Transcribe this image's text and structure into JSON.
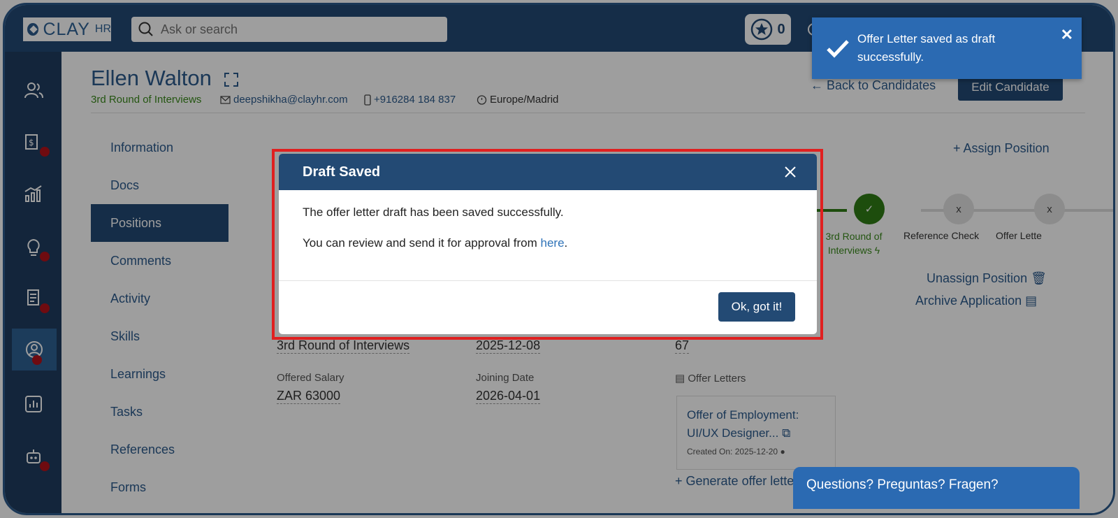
{
  "brand": {
    "name": "CLAY",
    "suffix": "HR"
  },
  "search": {
    "placeholder": "Ask or search"
  },
  "header": {
    "star_count": "0"
  },
  "candidate": {
    "name": "Ellen Walton",
    "stage": "3rd Round of Interviews",
    "email": "deepshikha@clayhr.com",
    "phone": "+916284 184 837",
    "timezone": "Europe/Madrid",
    "back_link": "Back to Candidates",
    "edit_button": "Edit Candidate"
  },
  "nav": {
    "items": [
      {
        "label": "Information"
      },
      {
        "label": "Docs"
      },
      {
        "label": "Positions"
      },
      {
        "label": "Comments"
      },
      {
        "label": "Activity"
      },
      {
        "label": "Skills"
      },
      {
        "label": "Learnings"
      },
      {
        "label": "Tasks"
      },
      {
        "label": "References"
      },
      {
        "label": "Forms"
      }
    ]
  },
  "positions": {
    "assign": "Assign Position",
    "unassign": "Unassign Position",
    "archive": "Archive Application",
    "steps": [
      {
        "label": "3rd Round of Interviews",
        "status": "done",
        "symbol": "✓"
      },
      {
        "label": "Reference Check",
        "status": "pending",
        "symbol": "x"
      },
      {
        "label": "Offer Lette",
        "status": "pending",
        "symbol": "x"
      }
    ],
    "fields": {
      "stage_value": "3rd Round of Interviews",
      "date_value": "2025-12-08",
      "score_value": "67",
      "offered_salary_label": "Offered Salary",
      "offered_salary": "ZAR 63000",
      "joining_date_label": "Joining Date",
      "joining_date": "2026-04-01",
      "offer_letters_label": "Offer Letters"
    },
    "offer_card": {
      "title": "Offer of Employment: UI/UX Designer...",
      "created": "Created On: 2025-12-20"
    },
    "generate": "Generate offer lette"
  },
  "modal": {
    "title": "Draft Saved",
    "line1": "The offer letter draft has been saved successfully.",
    "line2_prefix": "You can review and send it for approval from ",
    "line2_link": "here",
    "line2_suffix": ".",
    "ok_button": "Ok, got it!"
  },
  "toast": {
    "message": "Offer Letter saved as draft successfully."
  },
  "chat": {
    "label": "Questions? Preguntas? Fragen?"
  }
}
